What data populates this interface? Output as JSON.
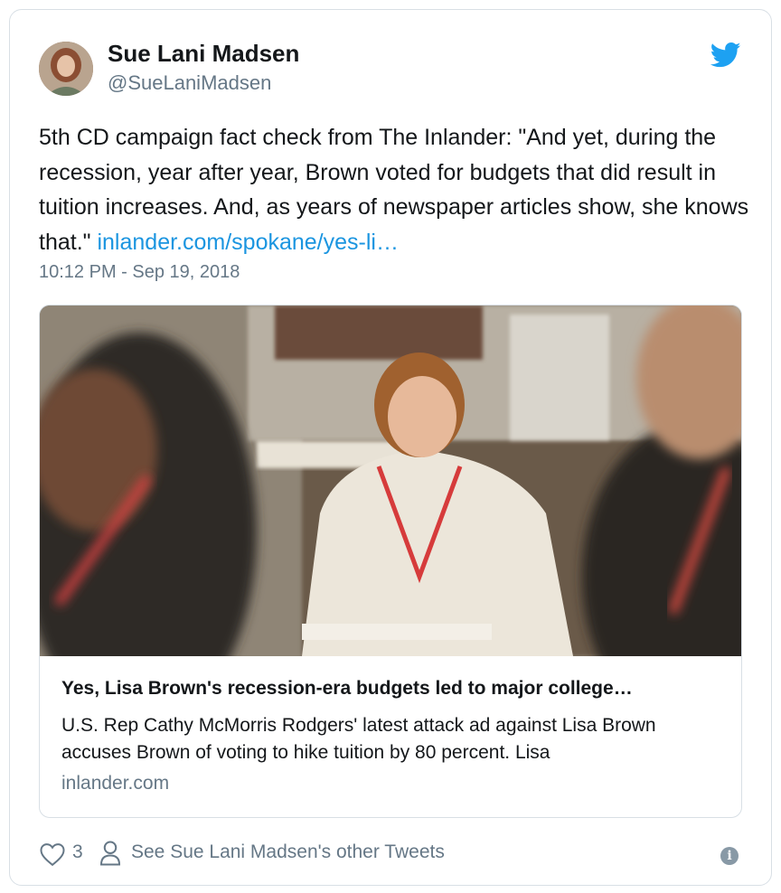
{
  "author": {
    "name": "Sue Lani Madsen",
    "handle": "@SueLaniMadsen"
  },
  "tweet": {
    "text": "5th CD campaign fact check from The Inlander: \"And yet, during the recession, year after year, Brown voted for budgets that did result in tuition increases. And, as years of newspaper articles show, she knows that.\" ",
    "link_text": "inlander.com/spokane/yes-li…",
    "timestamp": "10:12 PM - Sep 19, 2018"
  },
  "link_card": {
    "title": "Yes, Lisa Brown's recession-era budgets led to major college…",
    "description": "U.S. Rep Cathy McMorris Rodgers' latest attack ad against Lisa Brown accuses Brown of voting to hike tuition by 80 percent. Lisa",
    "domain": "inlander.com"
  },
  "footer": {
    "likes": "3",
    "other_tweets": "See Sue Lani Madsen's other Tweets"
  },
  "icons": {
    "brand": "twitter-bird-icon",
    "like": "heart-icon",
    "profile": "person-icon",
    "info": "info-icon"
  },
  "colors": {
    "link": "#1b95e0",
    "muted": "#657786",
    "border": "#d8dfe5"
  }
}
